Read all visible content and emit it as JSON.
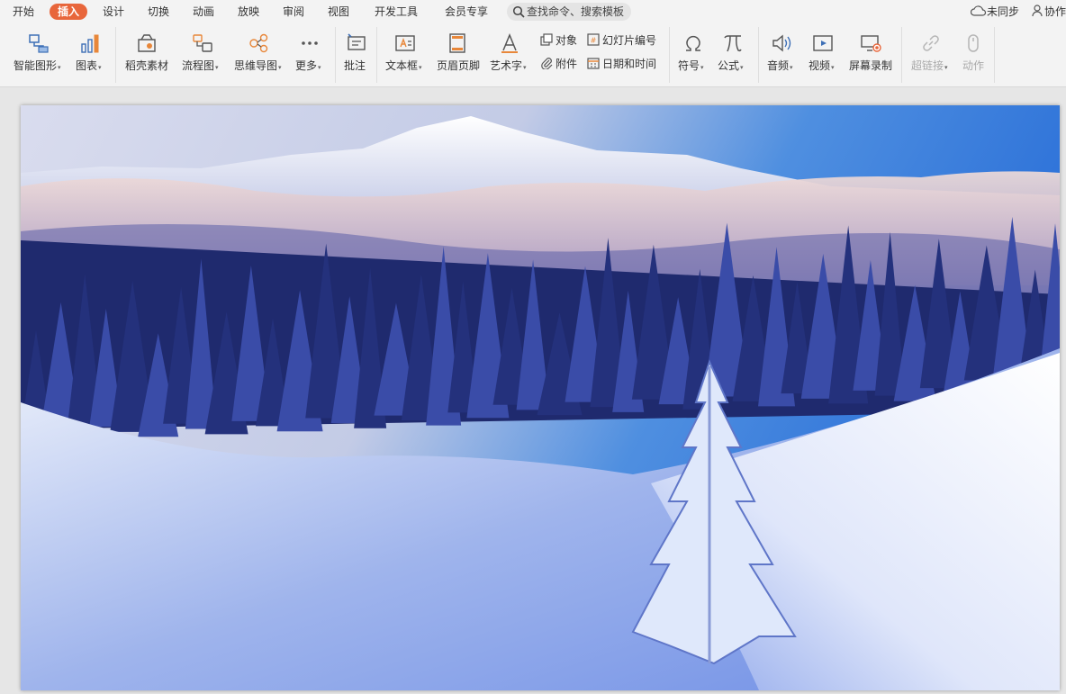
{
  "menu": {
    "items": [
      "开始",
      "插入",
      "设计",
      "切换",
      "动画",
      "放映",
      "审阅",
      "视图",
      "开发工具",
      "会员专享"
    ],
    "active": "插入",
    "search_placeholder": "查找命令、搜索模板",
    "sync_label": "未同步",
    "collab_label": "协作"
  },
  "ribbon": {
    "smart_shape": "智能图形",
    "chart": "图表",
    "docer_material": "稻壳素材",
    "flowchart": "流程图",
    "mindmap": "思维导图",
    "more": "更多",
    "comment": "批注",
    "textbox": "文本框",
    "header_footer": "页眉页脚",
    "wordart": "艺术字",
    "object": "对象",
    "attachment": "附件",
    "slide_number": "幻灯片编号",
    "date_time": "日期和时间",
    "symbol": "符号",
    "formula": "公式",
    "audio": "音频",
    "video": "视频",
    "screen_record": "屏幕录制",
    "hyperlink": "超链接",
    "action": "动作",
    "dropdown_glyph": "▾"
  },
  "colors": {
    "accent": "#e8663b",
    "ribbon_bg": "#f3f3f3",
    "icon_blue": "#3d6fb6",
    "icon_orange": "#e8873a"
  },
  "slide": {
    "content": "snowy mountain landscape photo"
  }
}
